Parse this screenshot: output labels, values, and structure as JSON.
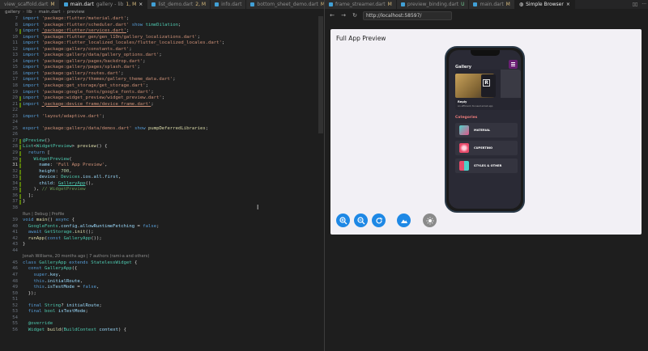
{
  "editor": {
    "tabs": [
      {
        "label": "view_scaffold.dart",
        "status": "M",
        "active": false
      },
      {
        "label": "main.dart",
        "extra": "gallery - lib",
        "status": "1, M",
        "active": true
      },
      {
        "label": "list_demo.dart",
        "status": "2, M",
        "active": false
      },
      {
        "label": "info.dart",
        "status": "",
        "active": false
      },
      {
        "label": "bottom_sheet_demo.dart",
        "status": "M",
        "active": false
      }
    ],
    "breadcrumb": [
      "gallery",
      "lib",
      "main.dart",
      "preview"
    ],
    "lens_run": "Run | Debug | Profile",
    "lens_blame": "Jonah Williams, 20 months ago | 7 authors (rami-a and others)"
  },
  "browser": {
    "tabs": [
      {
        "label": "frame_streamer.dart",
        "status": "M"
      },
      {
        "label": "preview_binding.dart",
        "status": "U"
      },
      {
        "label": "main.dart",
        "status": "M"
      },
      {
        "label": "Simple Browser",
        "status": ""
      }
    ],
    "url": "http://localhost:58597/",
    "preview_title": "Full App Preview"
  },
  "app": {
    "title": "Gallery",
    "hero_label": "Reply",
    "hero_sub": "An efficient, focused email app",
    "hero_logo": "R",
    "categories_title": "Categories",
    "categories": [
      "MATERIAL",
      "CUPERTINO",
      "STYLES & OTHER"
    ]
  },
  "colors": {
    "accent_blue": "#1e88e5",
    "toggle_gray": "#8a8a8a",
    "categories_red": "#e77a7a",
    "phone_border": "#2b3a48"
  },
  "icons": {
    "zoom_in": "zoom-in-icon",
    "zoom_out": "zoom-out-icon",
    "rotate": "rotate-icon",
    "landscape": "landscape-icon",
    "theme": "brightness-icon"
  }
}
